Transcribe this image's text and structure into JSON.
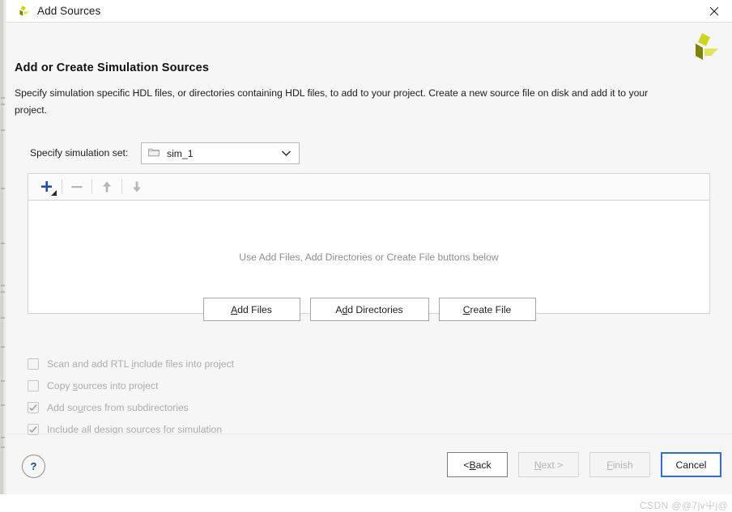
{
  "window": {
    "title": "Add Sources",
    "logo_icon": "vivado-logo-icon",
    "close_icon": "close-icon"
  },
  "header": {
    "title": "Add or Create Simulation Sources",
    "description": "Specify simulation specific HDL files, or directories containing HDL files, to add to your project. Create a new source file on disk and add it to your project.",
    "brand_icon": "xilinx-logo-icon"
  },
  "simulation_set": {
    "label": "Specify simulation set:",
    "value": "sim_1",
    "folder_icon": "folder-icon",
    "chevron_icon": "chevron-down-icon",
    "options": [
      "sim_1"
    ]
  },
  "file_list": {
    "empty_message": "Use Add Files, Add Directories or Create File buttons below",
    "toolbar": [
      {
        "name": "add",
        "icon": "plus-icon",
        "enabled": true
      },
      {
        "name": "remove",
        "icon": "minus-icon",
        "enabled": false
      },
      {
        "name": "move-up",
        "icon": "arrow-up-icon",
        "enabled": false
      },
      {
        "name": "move-down",
        "icon": "arrow-down-icon",
        "enabled": false
      }
    ]
  },
  "actions": [
    {
      "label_pre": "",
      "mnemonic": "A",
      "label_post": "dd Files",
      "name": "add-files"
    },
    {
      "label_pre": "A",
      "mnemonic": "d",
      "label_post": "d Directories",
      "name": "add-directories"
    },
    {
      "label_pre": "",
      "mnemonic": "C",
      "label_post": "reate File",
      "name": "create-file"
    }
  ],
  "options": [
    {
      "label_pre": "Scan and add RTL ",
      "mnemonic": "i",
      "label_post": "nclude files into project",
      "checked": false,
      "enabled": false,
      "name": "scan-rtl-include"
    },
    {
      "label_pre": "Copy ",
      "mnemonic": "s",
      "label_post": "ources into project",
      "checked": false,
      "enabled": false,
      "name": "copy-sources"
    },
    {
      "label_pre": "Add so",
      "mnemonic": "u",
      "label_post": "rces from subdirectories",
      "checked": true,
      "enabled": false,
      "name": "add-sources-subdirs"
    },
    {
      "label_pre": "Include all design s",
      "mnemonic": "o",
      "label_post": "urces for simulation",
      "checked": true,
      "enabled": false,
      "name": "include-design-sources"
    }
  ],
  "footer": {
    "help_label": "?",
    "buttons": [
      {
        "label_pre": "< ",
        "mnemonic": "B",
        "label_post": "ack",
        "name": "back",
        "state": "normal"
      },
      {
        "label_pre": "",
        "mnemonic": "N",
        "label_post": "ext >",
        "name": "next",
        "state": "disabled"
      },
      {
        "label_pre": "",
        "mnemonic": "F",
        "label_post": "inish",
        "name": "finish",
        "state": "disabled"
      },
      {
        "label_pre": "",
        "mnemonic": "",
        "label_post": "Cancel",
        "name": "cancel",
        "state": "focused"
      }
    ]
  },
  "watermark": {
    "text": "CSDN @@7jv屮j@"
  },
  "colors": {
    "accent_blue": "#16448a",
    "focus_blue": "#2f6fd0",
    "brand_olive": "#7f8100",
    "brand_lime": "#cdd51f",
    "dialog_bg": "#f6f6f6",
    "panel_bg": "#ffffff",
    "disabled_text": "#acacac"
  }
}
